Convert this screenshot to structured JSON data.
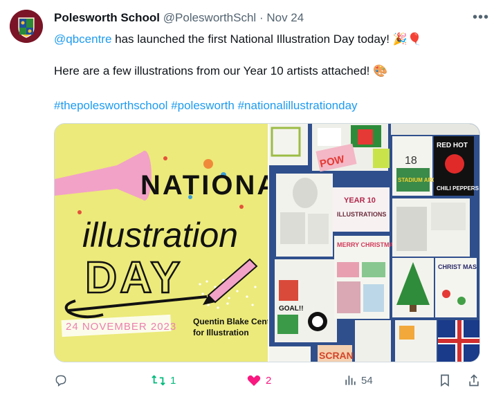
{
  "author": {
    "name": "Polesworth School",
    "handle": "@PolesworthSchl",
    "separator": "·",
    "date": "Nov 24"
  },
  "tweet": {
    "mention": "@qbcentre",
    "line1_rest": " has launched the first National Illustration Day today! 🎉🎈",
    "line2": "Here are a few illustrations from our Year 10 artists attached! 🎨",
    "hashtags": [
      "#thepolesworthschool",
      "#polesworth",
      "#nationalillustrationday"
    ]
  },
  "poster": {
    "word1": "NATIONAL",
    "word2": "illustration",
    "word3": "DAY",
    "date": "24 NOVEMBER 2023",
    "credit_line1": "Quentin Blake Centre",
    "credit_line2": "for Illustration"
  },
  "photo": {
    "card_year": "YEAR 10",
    "card_title": "ILLUSTRATIONS",
    "card_merry": "MERRY CHRISTMAS",
    "card_rhcp1": "RED HOT",
    "card_rhcp2": "CHILI PEPPERS",
    "card_stadium": "STADIUM ARCADIUM",
    "card_xmas": "CHRIST MAS",
    "card_goal": "GOAL!!",
    "card_scran": "SCRAN",
    "card_pow": "POW",
    "card_num": "18"
  },
  "actions": {
    "replies": "",
    "retweets": "1",
    "likes": "2",
    "views": "54"
  },
  "colors": {
    "link": "#1d9bf0",
    "retweet": "#00ba7c",
    "like": "#f91880",
    "muted": "#536471",
    "poster_bg": "#ecea7a",
    "board_bg": "#2f4f8c"
  }
}
